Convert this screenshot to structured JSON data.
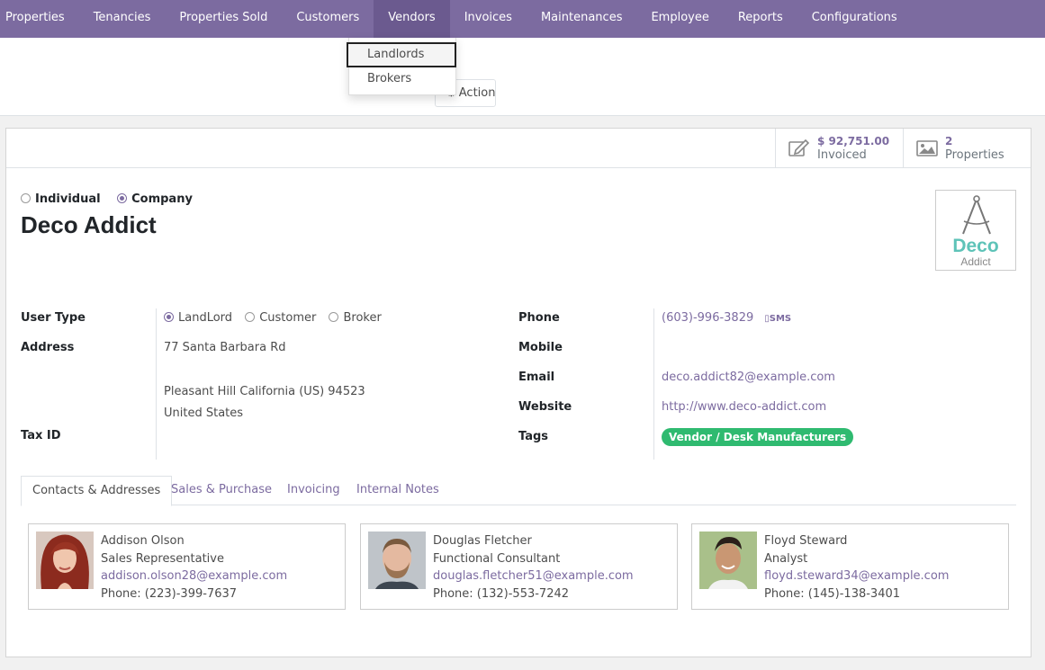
{
  "nav": {
    "items": [
      "Properties",
      "Tenancies",
      "Properties Sold",
      "Customers",
      "Vendors",
      "Invoices",
      "Maintenances",
      "Employee",
      "Reports",
      "Configurations"
    ],
    "active": "Vendors"
  },
  "dropdown": {
    "items": [
      "Landlords",
      "Brokers"
    ]
  },
  "control": {
    "action_label": "Action"
  },
  "stats": {
    "invoiced_value": "$ 92,751.00",
    "invoiced_label": "Invoiced",
    "properties_value": "2",
    "properties_label": "Properties"
  },
  "company_type": {
    "individual_label": "Individual",
    "company_label": "Company",
    "selected": "Company"
  },
  "partner": {
    "name": "Deco Addict",
    "logo_text_1": "Deco",
    "logo_text_2": "Addict"
  },
  "left_fields": {
    "user_type_label": "User Type",
    "user_type_options": [
      "LandLord",
      "Customer",
      "Broker"
    ],
    "user_type_selected": "LandLord",
    "address_label": "Address",
    "address_street": "77 Santa Barbara Rd",
    "address_city_line": "Pleasant Hill  California (US)  94523",
    "address_country": "United States",
    "tax_id_label": "Tax ID"
  },
  "right_fields": {
    "phone_label": "Phone",
    "phone_value": "(603)-996-3829",
    "sms_label": "SMS",
    "mobile_label": "Mobile",
    "email_label": "Email",
    "email_value": "deco.addict82@example.com",
    "website_label": "Website",
    "website_value": "http://www.deco-addict.com",
    "tags_label": "Tags",
    "tag_value": "Vendor / Desk Manufacturers"
  },
  "tabs": [
    "Contacts & Addresses",
    "Sales & Purchase",
    "Invoicing",
    "Internal Notes"
  ],
  "contacts": [
    {
      "name": "Addison Olson",
      "title": "Sales Representative",
      "email": "addison.olson28@example.com",
      "phone": "Phone: (223)-399-7637"
    },
    {
      "name": "Douglas Fletcher",
      "title": "Functional Consultant",
      "email": "douglas.fletcher51@example.com",
      "phone": "Phone: (132)-553-7242"
    },
    {
      "name": "Floyd Steward",
      "title": "Analyst",
      "email": "floyd.steward34@example.com",
      "phone": "Phone: (145)-138-3401"
    }
  ],
  "colors": {
    "brand": "#7c6ba0",
    "tag_green": "#2fba70",
    "logo_teal": "#5ec3b8"
  }
}
